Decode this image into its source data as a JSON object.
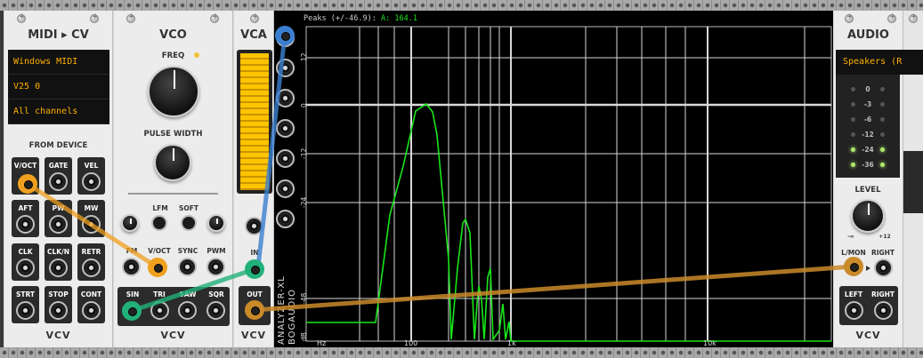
{
  "midi": {
    "title": "MIDI ▸ CV",
    "driver": "Windows MIDI",
    "device": "V25 0",
    "channel": "All channels",
    "section": "FROM DEVICE",
    "ports": [
      "V/OCT",
      "GATE",
      "VEL",
      "AFT",
      "PW",
      "MW",
      "CLK",
      "CLK/N",
      "RETR",
      "STRT",
      "STOP",
      "CONT"
    ],
    "logo": "VCV"
  },
  "vco": {
    "title": "VCO",
    "freq_label": "FREQ",
    "pulse_width_label": "PULSE WIDTH",
    "lfm_label": "LFM",
    "soft_label": "SOFT",
    "inputs": [
      "FM",
      "V/OCT",
      "SYNC",
      "PWM"
    ],
    "outputs": [
      "SIN",
      "TRI",
      "SAW",
      "SQR"
    ],
    "logo": "VCV"
  },
  "vca": {
    "title": "VCA",
    "in_label": "IN",
    "out_label": "OUT",
    "logo": "VCV",
    "level_fraction": 1.0
  },
  "analyzer": {
    "peaks_text": "Peaks (+/-46.9):",
    "peak_channel": "A:",
    "peak_value": "164.1",
    "brand_line1": "ANALYZER-XL",
    "brand_line2": "BOGAUDIO",
    "y_ticks": [
      "12",
      "0",
      "-12",
      "-24",
      "-48",
      "dB"
    ],
    "x_ticks": [
      "Hz",
      "100",
      "1k",
      "10k"
    ],
    "colors": {
      "trace": "#19e619",
      "grid": "#d8d8d8",
      "peak_value": "#19e619"
    }
  },
  "audio": {
    "title": "AUDIO",
    "device": "Speakers (R",
    "meter_labels": [
      "0",
      "-3",
      "-6",
      "-12",
      "-24",
      "-36"
    ],
    "meter_lit": [
      false,
      false,
      false,
      false,
      true,
      true
    ],
    "level_label": "LEVEL",
    "level_min": "-∞",
    "level_max": "+12",
    "lmon_label": "L/MON",
    "right_label": "RIGHT",
    "left_label": "LEFT",
    "right2_label": "RIGHT",
    "logo": "VCV"
  },
  "cables": {
    "colors": {
      "orange": "#f0a020",
      "green": "#22b07a",
      "blue": "#3b7fd0",
      "brown": "#c98a2a"
    }
  }
}
